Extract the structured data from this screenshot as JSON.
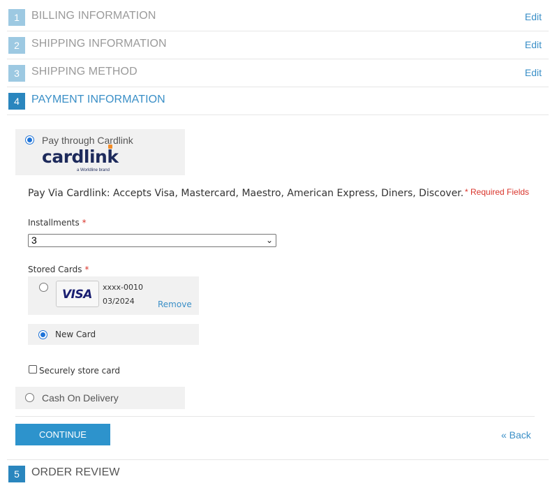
{
  "steps": [
    {
      "number": "1",
      "title": "BILLING INFORMATION",
      "edit": "Edit"
    },
    {
      "number": "2",
      "title": "SHIPPING INFORMATION",
      "edit": "Edit"
    },
    {
      "number": "3",
      "title": "SHIPPING METHOD",
      "edit": "Edit"
    },
    {
      "number": "4",
      "title": "PAYMENT INFORMATION"
    },
    {
      "number": "5",
      "title": "ORDER REVIEW"
    }
  ],
  "payment": {
    "cardlink_option": "Pay through Cardlink",
    "cardlink_logo": "cardlink",
    "cardlink_logo_sub": "a Worldline brand",
    "description": "Pay Via Cardlink: Accepts Visa, Mastercard, Maestro, American Express, Diners, Discover.",
    "required_fields": "* Required Fields",
    "installments_label": "Installments",
    "installments_value": "3",
    "stored_cards_label": "Stored Cards",
    "required_star": "*",
    "stored_card": {
      "brand": "VISA",
      "number": "xxxx-0010",
      "expiry": "03/2024",
      "remove": "Remove"
    },
    "new_card": "New Card",
    "store_card": "Securely store card",
    "cod_option": "Cash On Delivery"
  },
  "actions": {
    "continue": "CONTINUE",
    "back": "« Back"
  },
  "colors": {
    "accent": "#2a86be",
    "step_inactive": "#9dc9e2",
    "link": "#3a8fc7",
    "required": "#d9342b"
  }
}
